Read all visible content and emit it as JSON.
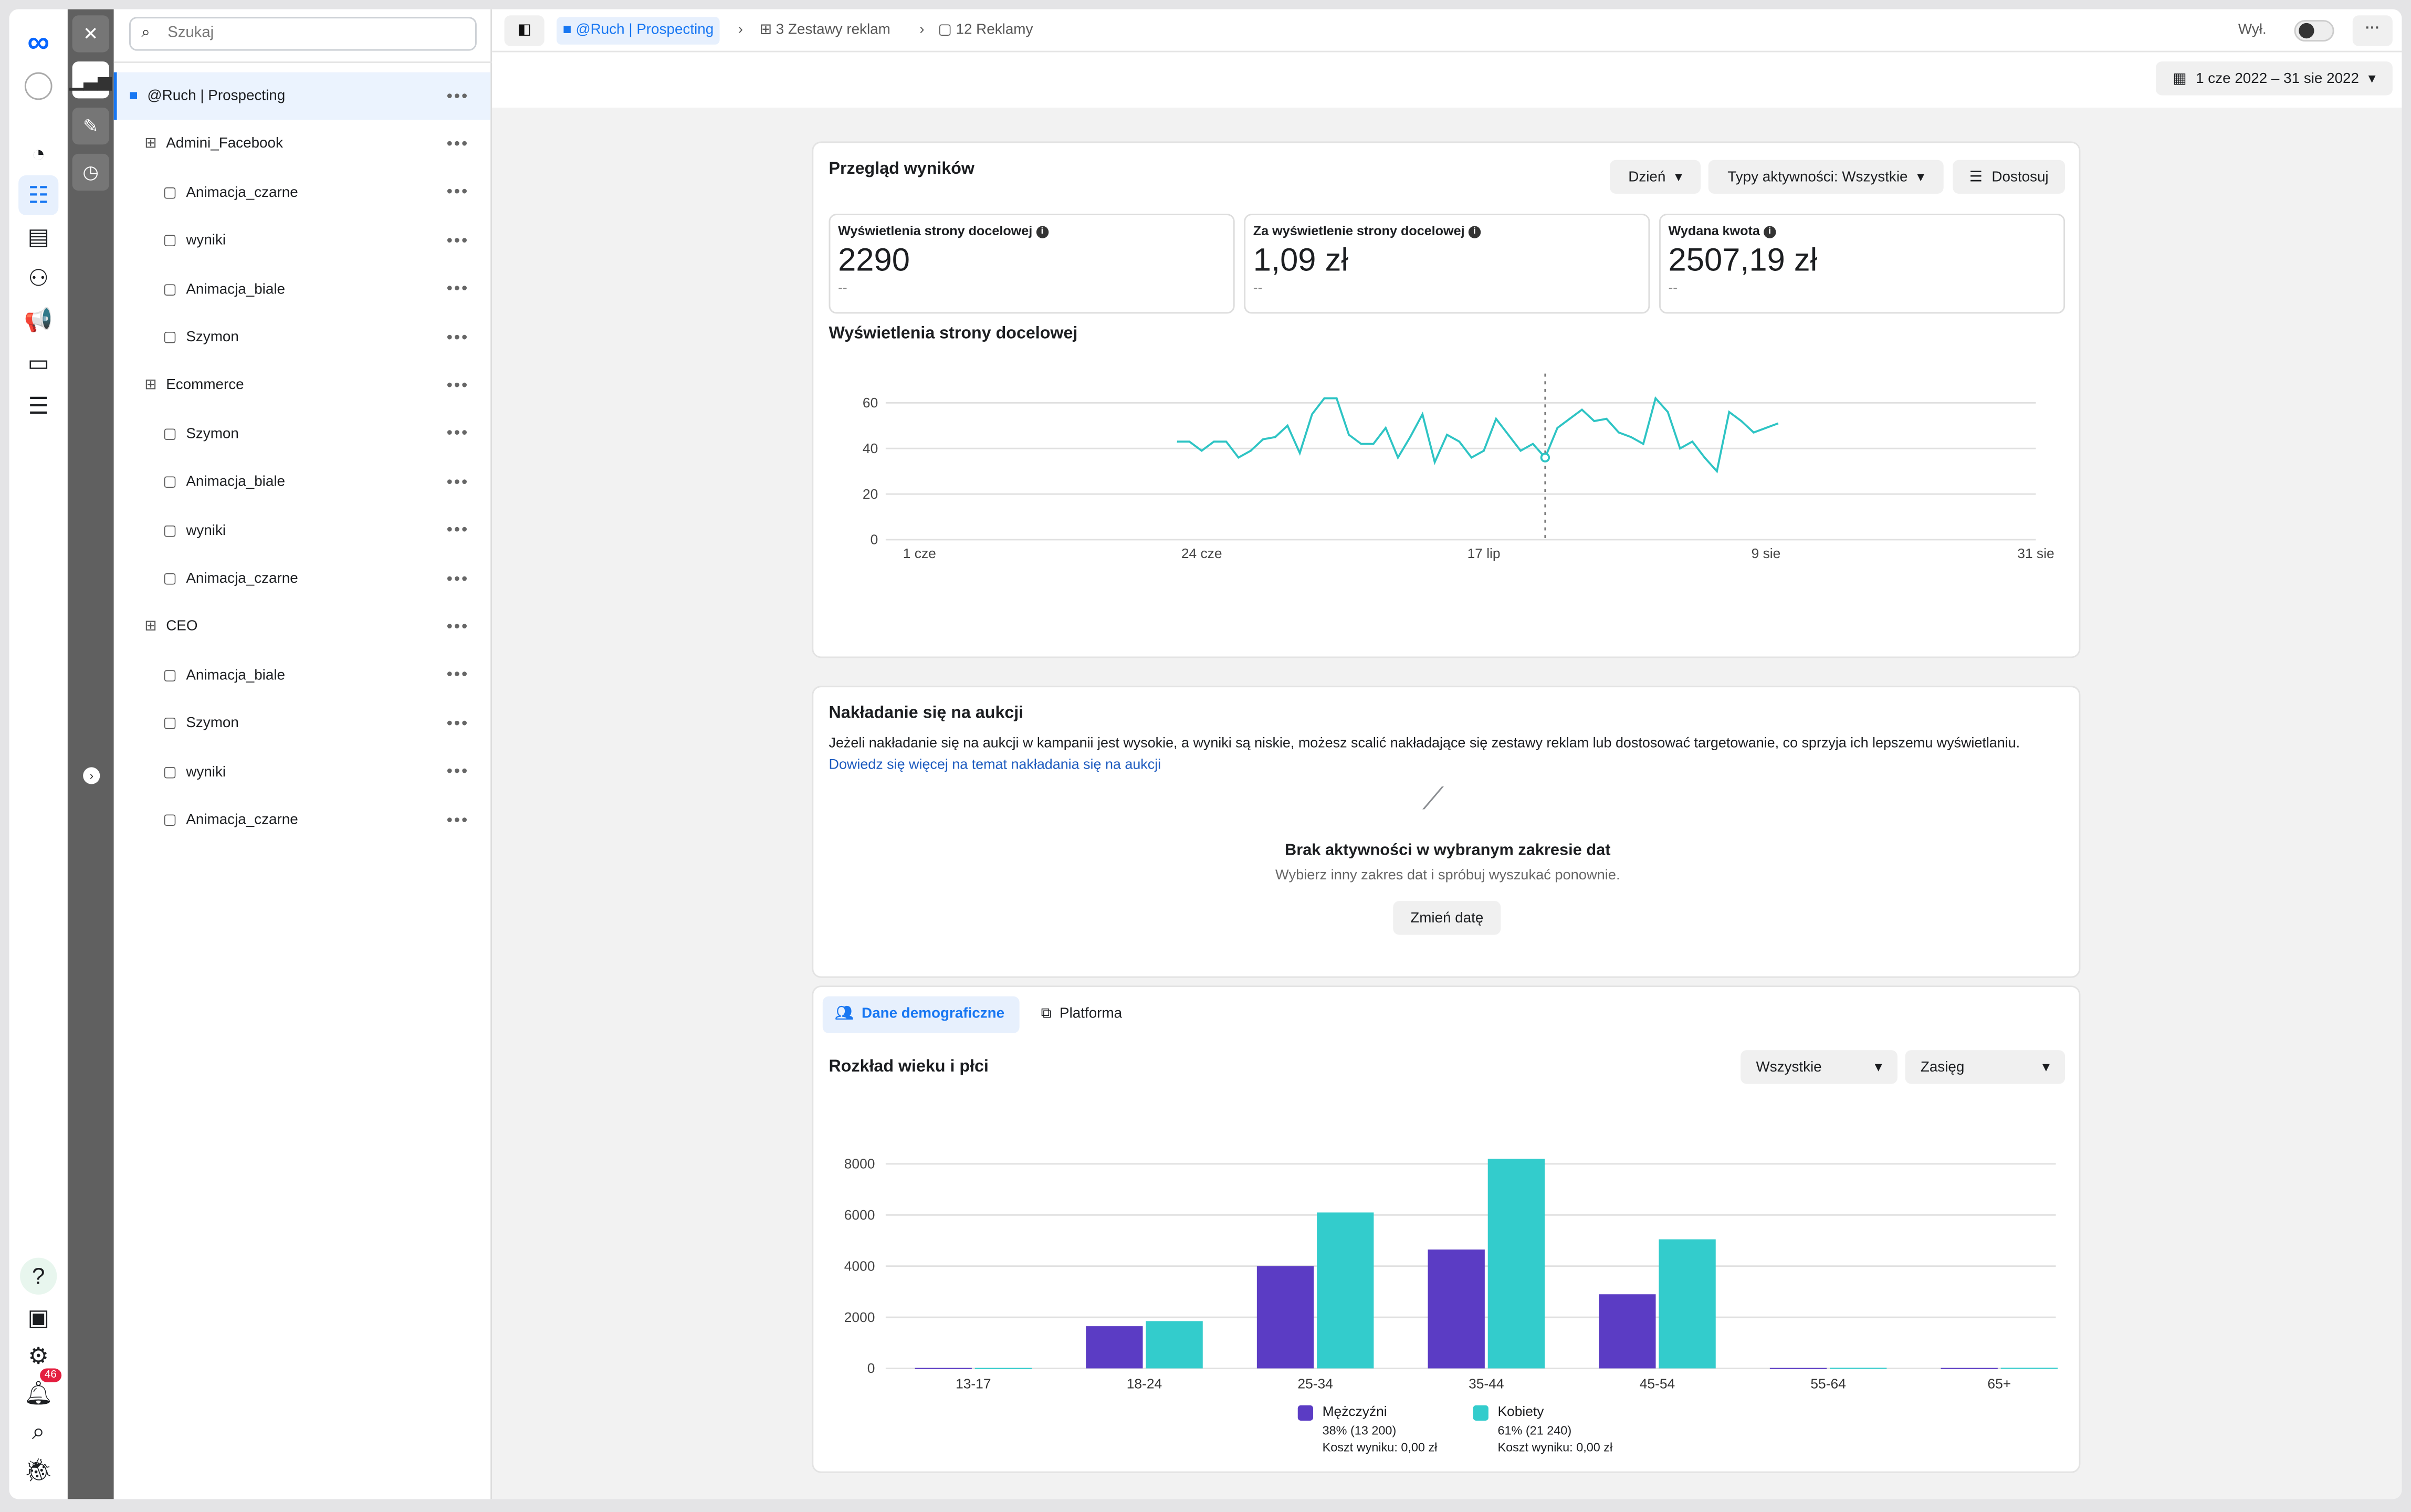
{
  "nav": {
    "notification_count": "46"
  },
  "tree": {
    "search_placeholder": "Szukaj",
    "items": [
      {
        "label": "@Ruch | Prospecting",
        "level": "campaign"
      },
      {
        "label": "Admini_Facebook",
        "level": "adset"
      },
      {
        "label": "Animacja_czarne",
        "level": "ad"
      },
      {
        "label": "wyniki",
        "level": "ad"
      },
      {
        "label": "Animacja_biale",
        "level": "ad"
      },
      {
        "label": "Szymon",
        "level": "ad"
      },
      {
        "label": "Ecommerce",
        "level": "adset"
      },
      {
        "label": "Szymon",
        "level": "ad"
      },
      {
        "label": "Animacja_biale",
        "level": "ad"
      },
      {
        "label": "wyniki",
        "level": "ad"
      },
      {
        "label": "Animacja_czarne",
        "level": "ad"
      },
      {
        "label": "CEO",
        "level": "adset"
      },
      {
        "label": "Animacja_biale",
        "level": "ad"
      },
      {
        "label": "Szymon",
        "level": "ad"
      },
      {
        "label": "wyniki",
        "level": "ad"
      },
      {
        "label": "Animacja_czarne",
        "level": "ad"
      }
    ]
  },
  "topbar": {
    "crumbs": [
      "@Ruch | Prospecting",
      "3 Zestawy reklam",
      "12 Reklamy"
    ],
    "toggle_label": "Wył.",
    "date_range": "1 cze 2022 – 31 sie 2022"
  },
  "overview": {
    "title": "Przegląd wyników",
    "day_button": "Dzień",
    "activity_button": "Typy aktywności: Wszystkie",
    "customize_button": "Dostosuj",
    "metrics": [
      {
        "label": "Wyświetlenia strony docelowej",
        "value": "2290",
        "delta": "--"
      },
      {
        "label": "Za wyświetlenie strony docelowej",
        "value": "1,09 zł",
        "delta": "--"
      },
      {
        "label": "Wydana kwota",
        "value": "2507,19 zł",
        "delta": "--"
      }
    ],
    "chart_title": "Wyświetlenia strony docelowej"
  },
  "overlap": {
    "title": "Nakładanie się na aukcji",
    "text": "Jeżeli nakładanie się na aukcji w kampanii jest wysokie, a wyniki są niskie, możesz scalić nakładające się zestawy reklam lub dostosować targetowanie, co sprzyja ich lepszemu wyświetlaniu.",
    "link": "Dowiedz się więcej na temat nakładania się na aukcji",
    "empty_title": "Brak aktywności w wybranym zakresie dat",
    "empty_text": "Wybierz inny zakres dat i spróbuj wyszukać ponownie.",
    "button": "Zmień datę"
  },
  "demo": {
    "tabs": [
      "Dane demograficzne",
      "Platforma"
    ],
    "title": "Rozkład wieku i płci",
    "filter": "Wszystkie",
    "metric": "Zasięg",
    "legend": [
      {
        "name": "Mężczyźni",
        "share": "38% (13 200)",
        "cost": "Koszt wyniku: 0,00 zł"
      },
      {
        "name": "Kobiety",
        "share": "61% (21 240)",
        "cost": "Koszt wyniku: 0,00 zł"
      }
    ]
  },
  "chart_data": [
    {
      "type": "line",
      "title": "Wyświetlenia strony docelowej",
      "xlim": [
        "2022-06-01",
        "2022-08-31"
      ],
      "ylim": [
        0,
        70
      ],
      "yticks": [
        0,
        20,
        40,
        60
      ],
      "xticks": [
        "1 cze",
        "24 cze",
        "17 lip",
        "9 sie",
        "31 sie"
      ],
      "xtick_dates": [
        "2022-06-01",
        "2022-06-24",
        "2022-07-17",
        "2022-08-09",
        "2022-08-31"
      ],
      "grid": true,
      "color": "#2ec4c4",
      "highlight_date": "2022-07-22",
      "start": "2022-06-22",
      "values": [
        43,
        43,
        39,
        43,
        43,
        36,
        39,
        44,
        45,
        50,
        38,
        55,
        62,
        62,
        46,
        42,
        42,
        49,
        36,
        45,
        55,
        34,
        46,
        43,
        36,
        39,
        53,
        46,
        39,
        42,
        36,
        49,
        53,
        57,
        52,
        53,
        47,
        45,
        42,
        62,
        56,
        40,
        43,
        36,
        30,
        56,
        52,
        47,
        49,
        51
      ]
    },
    {
      "type": "bar",
      "categories": [
        "13-17",
        "18-24",
        "25-34",
        "35-44",
        "45-54",
        "55-64",
        "65+"
      ],
      "ylim": [
        0,
        8000
      ],
      "yticks": [
        0,
        2000,
        4000,
        6000,
        8000
      ],
      "grid": true,
      "legend": "bottom",
      "series": [
        {
          "name": "Mężczyźni",
          "color": "#5b3cc4",
          "values": [
            20,
            1650,
            4000,
            4650,
            2900,
            20,
            20
          ]
        },
        {
          "name": "Kobiety",
          "color": "#33cccc",
          "values": [
            20,
            1850,
            6100,
            8200,
            5050,
            30,
            30
          ]
        }
      ]
    }
  ]
}
